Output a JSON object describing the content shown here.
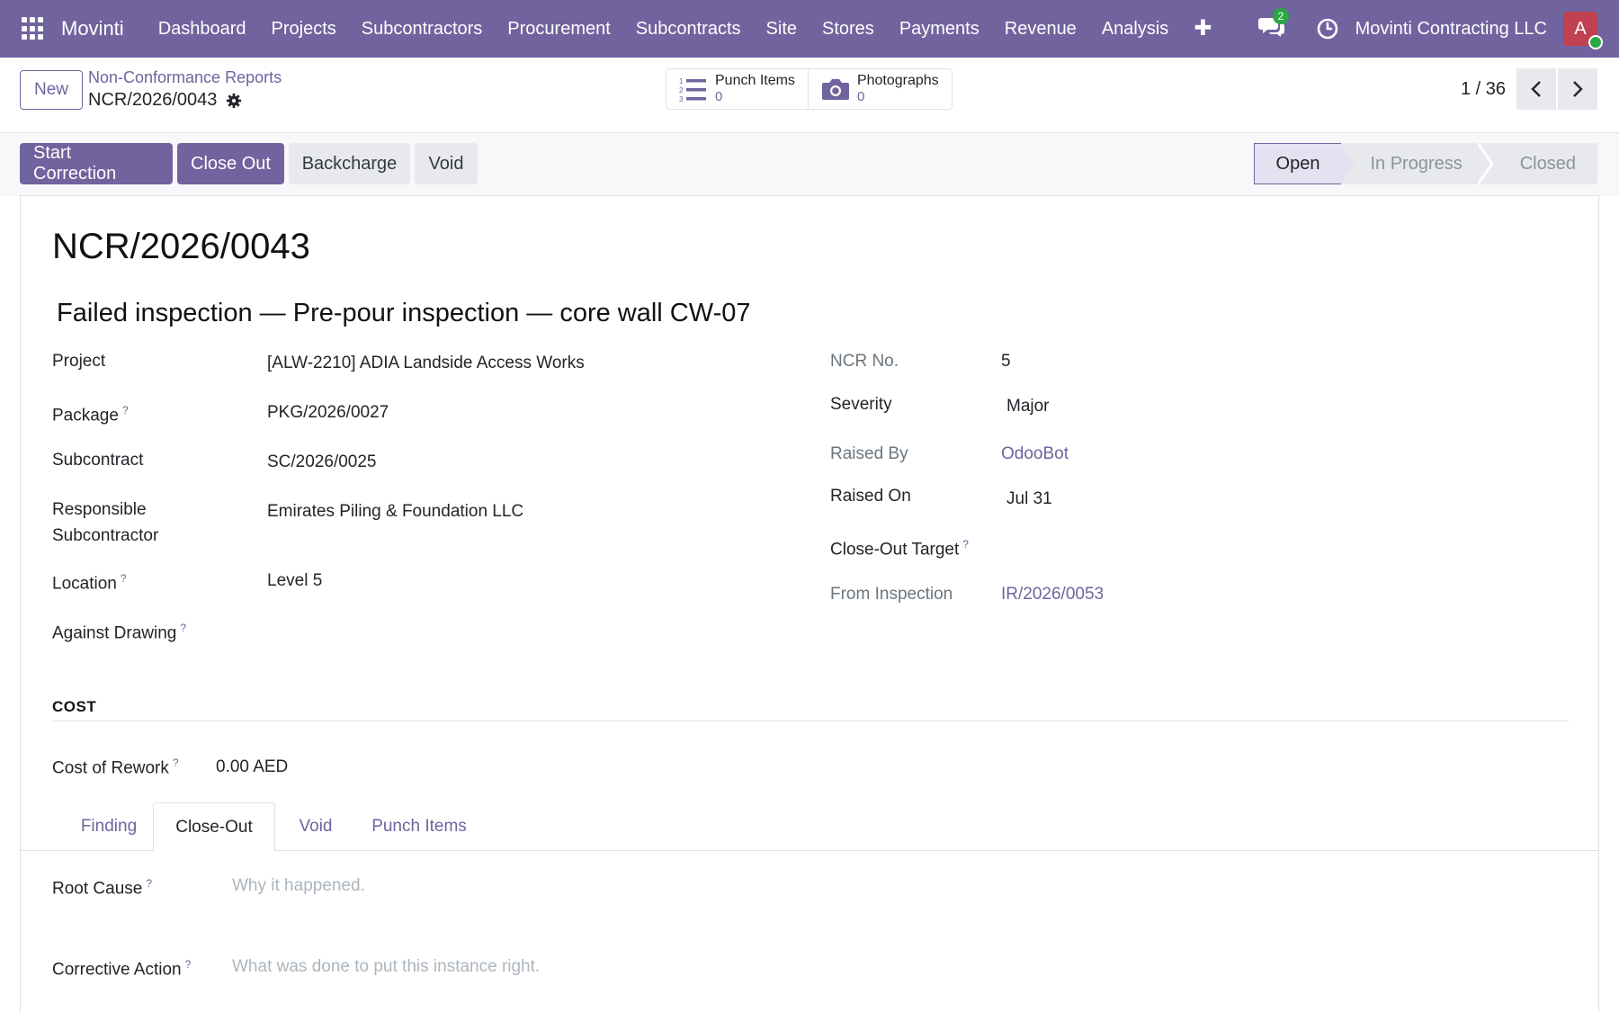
{
  "navbar": {
    "brand": "Movinti",
    "menu": [
      "Dashboard",
      "Projects",
      "Subcontractors",
      "Procurement",
      "Subcontracts",
      "Site",
      "Stores",
      "Payments",
      "Revenue",
      "Analysis"
    ],
    "chat_count": "2",
    "company": "Movinti Contracting LLC",
    "avatar_initial": "A"
  },
  "control": {
    "new_label": "New",
    "breadcrumb_parent": "Non-Conformance Reports",
    "breadcrumb_current": "NCR/2026/0043",
    "smart_buttons": [
      {
        "label": "Punch Items",
        "value": "0"
      },
      {
        "label": "Photographs",
        "value": "0"
      }
    ],
    "pager": "1 / 36"
  },
  "statusbar": {
    "actions": [
      "Start Correction",
      "Close Out",
      "Backcharge",
      "Void"
    ],
    "stages": [
      "Open",
      "In Progress",
      "Closed"
    ],
    "active_stage": "Open"
  },
  "record": {
    "title": "NCR/2026/0043",
    "subject": "Failed inspection — Pre-pour inspection — core wall CW-07",
    "left_fields": [
      {
        "label": "Project",
        "value": "[ALW-2210] ADIA Landside Access Works",
        "help": false
      },
      {
        "label": "Package",
        "value": "PKG/2026/0027",
        "help": true
      },
      {
        "label": "Subcontract",
        "value": "SC/2026/0025",
        "help": false
      },
      {
        "label": "Responsible Subcontractor",
        "value": "Emirates Piling & Foundation LLC",
        "help": false
      },
      {
        "label": "Location",
        "value": "Level 5",
        "help": true
      },
      {
        "label": "Against Drawing",
        "value": "",
        "help": true
      }
    ],
    "right_fields": [
      {
        "label": "NCR No.",
        "value": "5"
      },
      {
        "label": "Severity",
        "value": "Major"
      },
      {
        "label": "Raised By",
        "value": "OdooBot"
      },
      {
        "label": "Raised On",
        "value": "Jul 31"
      },
      {
        "label": "Close-Out Target",
        "value": ""
      },
      {
        "label": "From Inspection",
        "value": "IR/2026/0053"
      }
    ]
  },
  "cost": {
    "section_title": "COST",
    "label": "Cost of Rework",
    "value": "0.00 AED"
  },
  "tabs": [
    "Finding",
    "Close-Out",
    "Void",
    "Punch Items"
  ],
  "active_tab": "Close-Out",
  "closeout": {
    "root_cause_label": "Root Cause",
    "root_cause_placeholder": "Why it happened.",
    "corrective_action_label": "Corrective Action",
    "corrective_action_placeholder": "What was done to put this instance right."
  },
  "colors": {
    "brand": "#71639e",
    "avatar": "#c0414f",
    "online": "#28a745"
  }
}
